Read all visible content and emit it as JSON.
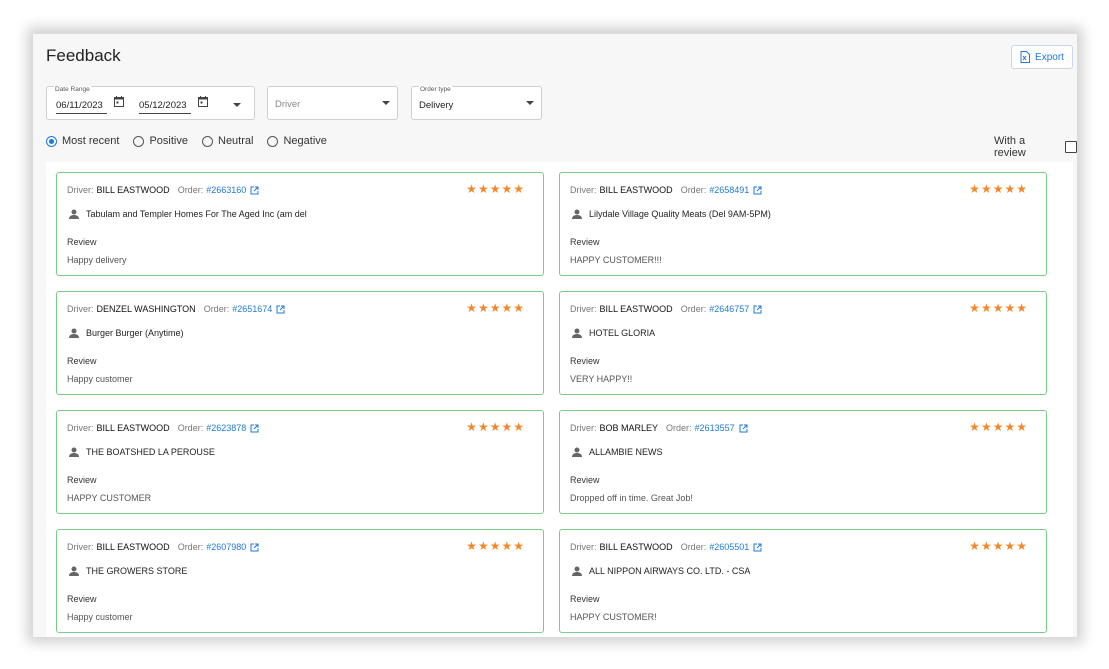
{
  "page": {
    "title": "Feedback"
  },
  "toolbar": {
    "export_label": "Export"
  },
  "filters": {
    "date_range": {
      "label": "Date Range",
      "start": "06/11/2023",
      "end": "05/12/2023"
    },
    "driver": {
      "placeholder": "Driver"
    },
    "order_type": {
      "label": "Order type",
      "value": "Delivery"
    }
  },
  "sentiment": {
    "options": [
      "Most recent",
      "Positive",
      "Neutral",
      "Negative"
    ],
    "selected": "Most recent"
  },
  "with_review": {
    "label": "With a review",
    "checked": false
  },
  "card_labels": {
    "driver": "Driver:",
    "order": "Order:",
    "review": "Review"
  },
  "colors": {
    "accent": "#1f7ad6",
    "star": "#f2882c",
    "card_border": "#7dcb87"
  },
  "cards": [
    {
      "driver": "BILL EASTWOOD",
      "order": "#2663160",
      "customer": "Tabulam and Templer Homes For The Aged Inc (am del",
      "review": "Happy delivery",
      "rating": 5
    },
    {
      "driver": "BILL EASTWOOD",
      "order": "#2658491",
      "customer": "Lilydale Village Quality Meats (Del 9AM-5PM)",
      "review": "HAPPY CUSTOMER!!!",
      "rating": 5
    },
    {
      "driver": "DENZEL WASHINGTON",
      "order": "#2651674",
      "customer": "Burger Burger (Anytime)",
      "review": "Happy customer",
      "rating": 5
    },
    {
      "driver": "BILL EASTWOOD",
      "order": "#2646757",
      "customer": "HOTEL GLORIA",
      "review": "VERY HAPPY!!",
      "rating": 5
    },
    {
      "driver": "BILL EASTWOOD",
      "order": "#2623878",
      "customer": "THE BOATSHED LA PEROUSE",
      "review": "HAPPY CUSTOMER",
      "rating": 5
    },
    {
      "driver": "BOB MARLEY",
      "order": "#2613557",
      "customer": "ALLAMBIE NEWS",
      "review": "Dropped off in time. Great Job!",
      "rating": 5
    },
    {
      "driver": "BILL EASTWOOD",
      "order": "#2607980",
      "customer": "THE GROWERS STORE",
      "review": "Happy customer",
      "rating": 5
    },
    {
      "driver": "BILL EASTWOOD",
      "order": "#2605501",
      "customer": "ALL NIPPON AIRWAYS CO. LTD. - CSA",
      "review": "HAPPY CUSTOMER!",
      "rating": 5
    }
  ]
}
